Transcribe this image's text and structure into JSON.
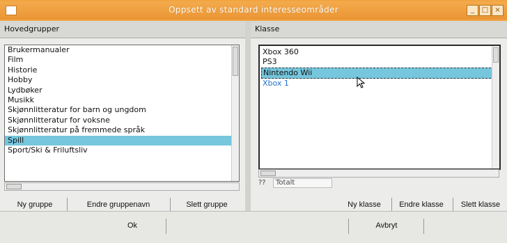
{
  "window": {
    "title": "Oppsett av standard interesseområder",
    "minimize_glyph": "_",
    "maximize_glyph": "□",
    "close_glyph": "×"
  },
  "left_pane": {
    "header": "Hovedgrupper",
    "items": [
      {
        "label": "Brukermanualer"
      },
      {
        "label": "Film"
      },
      {
        "label": "Historie"
      },
      {
        "label": "Hobby"
      },
      {
        "label": "Lydbøker"
      },
      {
        "label": "Musikk"
      },
      {
        "label": "Skjønnlitteratur for barn og ungdom"
      },
      {
        "label": "Skjønnlitteratur for voksne"
      },
      {
        "label": "Skjønnlitteratur på fremmede språk"
      },
      {
        "label": "Spill"
      },
      {
        "label": "Sport/Ski & Friluftsliv"
      }
    ],
    "selected_index": 9,
    "buttons": {
      "new": "Ny gruppe",
      "edit": "Endre gruppenavn",
      "delete": "Slett gruppe"
    }
  },
  "right_pane": {
    "header": "Klasse",
    "items": [
      {
        "label": "Xbox 360"
      },
      {
        "label": "PS3"
      },
      {
        "label": "Nintendo Wii"
      },
      {
        "label": "Xbox 1"
      }
    ],
    "selected_index": 2,
    "count_label": "??",
    "count_value": "Totalt",
    "buttons": {
      "new": "Ny klasse",
      "edit": "Endre klasse",
      "delete": "Slett klasse"
    }
  },
  "footer": {
    "ok": "Ok",
    "cancel": "Avbryt"
  },
  "colors": {
    "titlebar": "#f2a441",
    "selection": "#76c6dd",
    "accent_text": "#1f6fd0"
  }
}
